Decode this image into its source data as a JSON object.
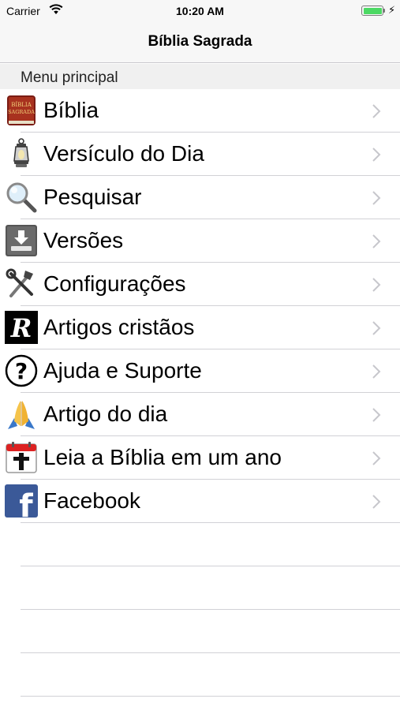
{
  "status_bar": {
    "carrier": "Carrier",
    "time": "10:20 AM",
    "battery_level": 1.0
  },
  "nav": {
    "title": "Bíblia Sagrada"
  },
  "section": {
    "title": "Menu principal"
  },
  "menu": [
    {
      "label": "Bíblia",
      "icon": "bible-book-icon"
    },
    {
      "label": "Versículo do Dia",
      "icon": "lantern-icon"
    },
    {
      "label": "Pesquisar",
      "icon": "magnifier-icon"
    },
    {
      "label": "Versões",
      "icon": "download-tray-icon"
    },
    {
      "label": "Configurações",
      "icon": "tools-icon"
    },
    {
      "label": "Artigos cristãos",
      "icon": "r-logo-icon"
    },
    {
      "label": "Ajuda e Suporte",
      "icon": "question-icon"
    },
    {
      "label": "Artigo do dia",
      "icon": "praying-hands-icon"
    },
    {
      "label": "Leia a Bíblia em um ano",
      "icon": "cross-calendar-icon"
    },
    {
      "label": "Facebook",
      "icon": "facebook-icon"
    }
  ],
  "icon_texts": {
    "bible_cover_line1": "BÍBLIA",
    "bible_cover_line2": "SAGRADA",
    "r_logo": "R",
    "question": "?",
    "facebook": "f"
  },
  "colors": {
    "chevron": "#c7c7cc",
    "separator": "#d1d1d6",
    "battery": "#4cd964",
    "facebook": "#3b5998"
  }
}
